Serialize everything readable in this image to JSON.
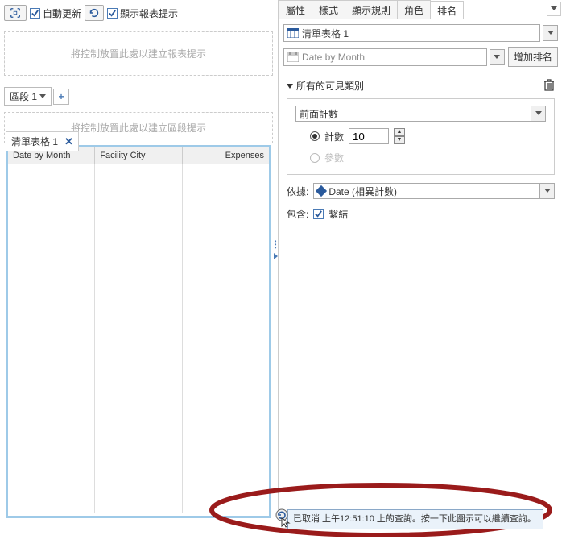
{
  "toolbar": {
    "auto_update_label": "自動更新",
    "show_report_prompt_label": "顯示報表提示"
  },
  "placeholders": {
    "report_prompt": "將控制放置此處以建立報表提示",
    "section_prompt": "將控制放置此處以建立區段提示"
  },
  "section": {
    "tab_label": "區段 1"
  },
  "list_table": {
    "tab_label": "清單表格 1",
    "columns": [
      "Date by Month",
      "Facility City",
      "Expenses"
    ]
  },
  "right_tabs": {
    "attrs": "屬性",
    "style": "樣式",
    "display_rules": "顯示規則",
    "role": "角色",
    "rank": "排名"
  },
  "rank_panel": {
    "target_select": "清單表格 1",
    "by_select": "Date by Month",
    "add_rank_btn": "增加排名",
    "all_visible_categories": "所有的可見類別",
    "top_count_label": "前面計數",
    "count_label": "計數",
    "count_value": "10",
    "param_label": "參數",
    "depends_label": "依據:",
    "depends_value": "Date (相異計數)",
    "include_label": "包含:",
    "tie_label": "繫結"
  },
  "tooltip": {
    "text": "已取消 上午12:51:10 上的查詢。按一下此圖示可以繼續查詢。"
  }
}
